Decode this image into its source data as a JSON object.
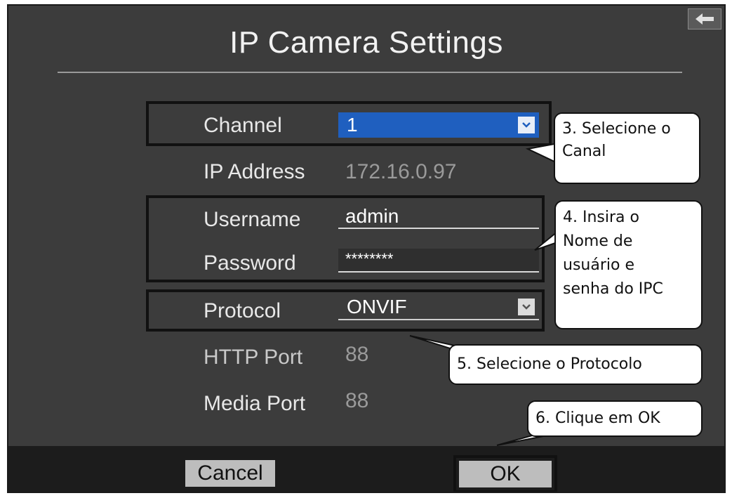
{
  "dialog": {
    "title": "IP Camera Settings",
    "back_icon": "back-arrow-icon"
  },
  "fields": {
    "channel": {
      "label": "Channel",
      "value": "1"
    },
    "ip_address": {
      "label": "IP Address",
      "value": "172.16.0.97"
    },
    "username": {
      "label": "Username",
      "value": "admin"
    },
    "password": {
      "label": "Password",
      "value": "********"
    },
    "protocol": {
      "label": "Protocol",
      "value": "ONVIF"
    },
    "http_port": {
      "label": "HTTP Port",
      "value": "88"
    },
    "media_port": {
      "label": "Media Port",
      "value": "88"
    }
  },
  "buttons": {
    "cancel": "Cancel",
    "ok": "OK"
  },
  "callouts": {
    "c3": {
      "line1": "3. Selecione o",
      "line2": "Canal"
    },
    "c4": {
      "line1": "4.  Insira  o",
      "line2": "Nome  de",
      "line3": "usuário  e",
      "line4": "senha do IPC"
    },
    "c5": {
      "line1": "5. Selecione o Protocolo"
    },
    "c6": {
      "line1": "6. Clique em OK"
    }
  },
  "colors": {
    "panel": "#3c3c3c",
    "footer": "#1c1c1c",
    "select_highlight": "#1f5fbf",
    "button": "#bdbdbd"
  }
}
